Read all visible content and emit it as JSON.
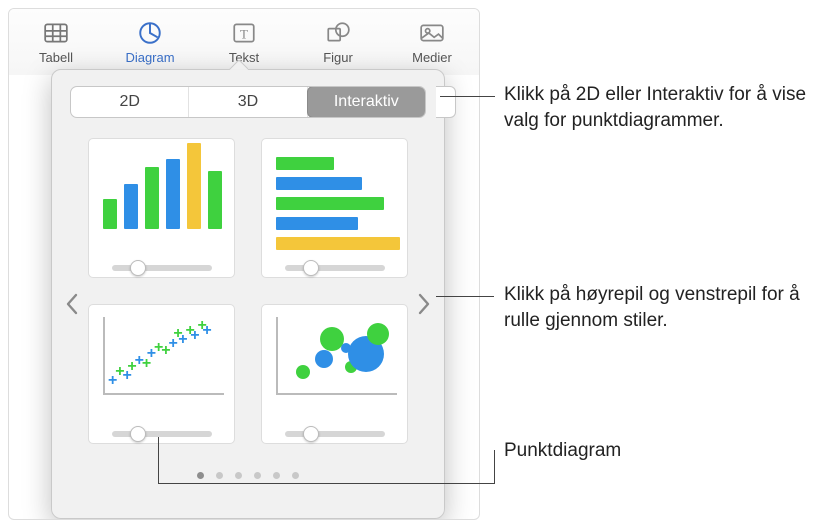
{
  "toolbar": {
    "items": [
      {
        "label": "Tabell"
      },
      {
        "label": "Diagram"
      },
      {
        "label": "Tekst"
      },
      {
        "label": "Figur"
      },
      {
        "label": "Medier"
      }
    ]
  },
  "popover": {
    "segments": {
      "a": "2D",
      "b": "3D",
      "c": "Interaktiv"
    },
    "page_count": 6,
    "active_page": 0
  },
  "colors": {
    "green": "#3fd13f",
    "blue": "#2f8fe6",
    "yellow": "#f4c63a"
  },
  "charts": {
    "column": {
      "heights": [
        30,
        45,
        62,
        70,
        86,
        58
      ]
    },
    "bar": {
      "widths": [
        58,
        86,
        108,
        82,
        124
      ]
    },
    "scatter_points": [
      {
        "x": 8,
        "y": 82,
        "c": "blue"
      },
      {
        "x": 14,
        "y": 70,
        "c": "green"
      },
      {
        "x": 20,
        "y": 76,
        "c": "blue"
      },
      {
        "x": 24,
        "y": 64,
        "c": "green"
      },
      {
        "x": 30,
        "y": 56,
        "c": "blue"
      },
      {
        "x": 36,
        "y": 60,
        "c": "green"
      },
      {
        "x": 40,
        "y": 48,
        "c": "blue"
      },
      {
        "x": 46,
        "y": 40,
        "c": "green"
      },
      {
        "x": 52,
        "y": 44,
        "c": "green"
      },
      {
        "x": 58,
        "y": 34,
        "c": "blue"
      },
      {
        "x": 62,
        "y": 22,
        "c": "green"
      },
      {
        "x": 66,
        "y": 30,
        "c": "blue"
      },
      {
        "x": 72,
        "y": 18,
        "c": "green"
      },
      {
        "x": 76,
        "y": 24,
        "c": "blue"
      },
      {
        "x": 82,
        "y": 12,
        "c": "green"
      },
      {
        "x": 86,
        "y": 18,
        "c": "blue"
      }
    ],
    "bubbles": [
      {
        "x": 22,
        "y": 70,
        "r": 7,
        "c": "green"
      },
      {
        "x": 40,
        "y": 54,
        "r": 9,
        "c": "blue"
      },
      {
        "x": 46,
        "y": 28,
        "r": 12,
        "c": "green"
      },
      {
        "x": 62,
        "y": 64,
        "r": 6,
        "c": "green"
      },
      {
        "x": 74,
        "y": 48,
        "r": 18,
        "c": "blue"
      },
      {
        "x": 84,
        "y": 22,
        "r": 11,
        "c": "green"
      },
      {
        "x": 58,
        "y": 40,
        "r": 5,
        "c": "blue"
      }
    ]
  },
  "callouts": {
    "top": "Klikk på 2D eller Interaktiv for å vise valg for punktdiagrammer.",
    "mid": "Klikk på høyrepil og venstrepil for å rulle gjennom stiler.",
    "bottom": "Punktdiagram"
  }
}
